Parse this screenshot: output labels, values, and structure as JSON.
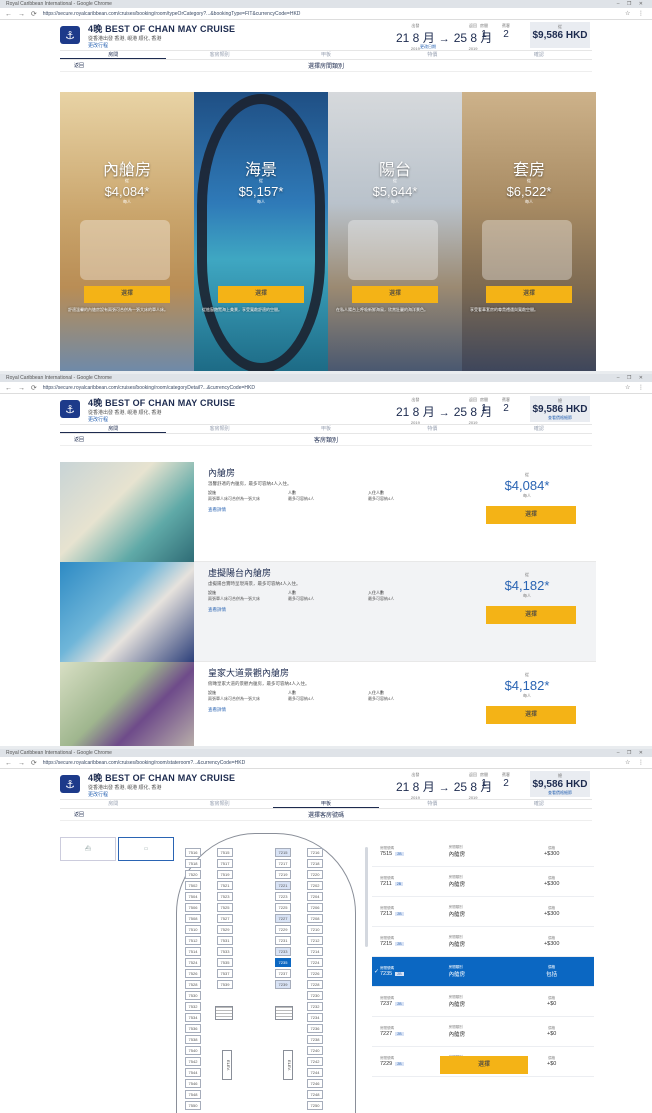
{
  "browser": {
    "window_title": "Royal Caribbean International - Google Chrome",
    "urls": [
      "https://secure.royalcaribbean.com/cruises/booking/room/typeOrCategory?...&bookingType=FIT&currencyCode=HKD",
      "https://secure.royalcaribbean.com/cruises/booking/room/categoryDetail?...&currencyCode=HKD",
      "https://secure.royalcaribbean.com/cruises/booking/room/stateroom?...&currencyCode=HKD"
    ]
  },
  "trip": {
    "title": "4晚 BEST OF CHAN MAY CRUISE",
    "subtitle": "從香港出發 香港, 峴港 顺化, 香港",
    "link": "更改行程",
    "depart_label": "出發",
    "depart": "21 8 月",
    "depart_year": "2019",
    "return_label": "返回",
    "return": "25 8 月",
    "return_year": "2019",
    "arrow": "→",
    "dates_link": "更改日期",
    "rooms_label": "房間",
    "rooms": "1",
    "guests_label": "賓客",
    "guests": "2",
    "total_label": "總",
    "total": "$9,586 HKD",
    "total_sub": "查看價格細節",
    "from_label": "從"
  },
  "steps": [
    "房間",
    "客房類別",
    "甲板",
    "特價",
    "確認"
  ],
  "frame1": {
    "back": "返回",
    "subtitle": "選擇房間類別",
    "categories": [
      {
        "name": "內艙房",
        "from": "從",
        "price": "$4,084*",
        "pp": "每人",
        "btn": "選擇",
        "desc": "舒適溫馨的內艙房設有兩張可合併為一張大床的單人床。"
      },
      {
        "name": "海景",
        "from": "從",
        "price": "$5,157*",
        "pp": "每人",
        "btn": "選擇",
        "desc": "從舷窗飽覽海上美景，享受寬敞舒適的空間。"
      },
      {
        "name": "陽台",
        "from": "從",
        "price": "$5,644*",
        "pp": "每人",
        "btn": "選擇",
        "desc": "在私人陽台上呼吸新鮮海風，欣賞壯麗的海洋景色。"
      },
      {
        "name": "套房",
        "from": "從",
        "price": "$6,522*",
        "pp": "每人",
        "btn": "選擇",
        "desc": "享受奢華套房的尊貴禮遇與寬敞空間。"
      }
    ]
  },
  "frame2": {
    "back": "返回",
    "subtitle": "客房類別",
    "rooms": [
      {
        "name": "內艙房",
        "desc": "溫馨舒適的內艙房，最多可容納4人入住。",
        "c1_label": "設施",
        "c1": "兩張單人床可合併為一張大床",
        "c2_label": "人數",
        "c2": "最多可容納4人",
        "c3_label": "入住人數",
        "c3": "最多可容納4人",
        "more": "查看詳情",
        "from": "從",
        "price": "$4,084*",
        "pp": "每人",
        "btn": "選擇"
      },
      {
        "name": "虛擬陽台內艙房",
        "desc": "虛擬陽台實時呈現海景，最多可容納4人入住。",
        "c1_label": "設施",
        "c1": "兩張單人床可合併為一張大床",
        "c2_label": "人數",
        "c2": "最多可容納4人",
        "c3_label": "入住人數",
        "c3": "最多可容納4人",
        "more": "查看詳情",
        "from": "從",
        "price": "$4,182*",
        "pp": "每人",
        "btn": "選擇"
      },
      {
        "name": "皇家大道景觀內艙房",
        "desc": "俯瞰皇家大道的景觀內艙房，最多可容納4人入住。",
        "c1_label": "設施",
        "c1": "兩張單人床可合併為一張大床",
        "c2_label": "人數",
        "c2": "最多可容納4人",
        "c3_label": "入住人數",
        "c3": "最多可容納4人",
        "more": "查看詳情",
        "from": "從",
        "price": "$4,182*",
        "pp": "每人",
        "btn": "選擇"
      }
    ]
  },
  "frame3": {
    "back": "返回",
    "subtitle": "選擇客房號碼",
    "elev": "ELEV.",
    "cabins_left": [
      "7516",
      "7518",
      "7520",
      "7502",
      "7504",
      "7506",
      "7508",
      "7510",
      "7512",
      "7514",
      "7524",
      "7526",
      "7528",
      "7530",
      "7532",
      "7534",
      "7536",
      "7538",
      "7540",
      "7542",
      "7544",
      "7546",
      "7548",
      "7550"
    ],
    "cabins_mid1": [
      "7515",
      "7517",
      "7519",
      "7521",
      "7523",
      "7525",
      "7527",
      "7529",
      "7531",
      "7533",
      "7535",
      "7537",
      "7539"
    ],
    "cabins_mid2": [
      "7215",
      "7217",
      "7219",
      "7221",
      "7223",
      "7225",
      "7227",
      "7229",
      "7231",
      "7233",
      "7235",
      "7237",
      "7239"
    ],
    "cabins_right": [
      "7216",
      "7218",
      "7220",
      "7202",
      "7204",
      "7206",
      "7208",
      "7210",
      "7212",
      "7214",
      "7224",
      "7226",
      "7228",
      "7230",
      "7232",
      "7234",
      "7236",
      "7238",
      "7240",
      "7242",
      "7244",
      "7246",
      "7248",
      "7250"
    ],
    "list": [
      {
        "l1": "房間號碼",
        "num": "7515",
        "tag": "2B",
        "l2": "房間類別",
        "type": "內艙房",
        "l3": "價格",
        "price": "+$300"
      },
      {
        "l1": "房間號碼",
        "num": "7211",
        "tag": "2B",
        "l2": "房間類別",
        "type": "內艙房",
        "l3": "價格",
        "price": "+$300"
      },
      {
        "l1": "房間號碼",
        "num": "7213",
        "tag": "2B",
        "l2": "房間類別",
        "type": "內艙房",
        "l3": "價格",
        "price": "+$300"
      },
      {
        "l1": "房間號碼",
        "num": "7215",
        "tag": "2B",
        "l2": "房間類別",
        "type": "內艙房",
        "l3": "價格",
        "price": "+$300"
      },
      {
        "l1": "房間號碼",
        "num": "7235",
        "tag": "2B",
        "l2": "房間類別",
        "type": "內艙房",
        "l3": "價格",
        "price": "包括"
      },
      {
        "l1": "房間號碼",
        "num": "7237",
        "tag": "2B",
        "l2": "房間類別",
        "type": "內艙房",
        "l3": "價格",
        "price": "+$0"
      },
      {
        "l1": "房間號碼",
        "num": "7227",
        "tag": "2B",
        "l2": "房間類別",
        "type": "內艙房",
        "l3": "價格",
        "price": "+$0"
      },
      {
        "l1": "房間號碼",
        "num": "7229",
        "tag": "2B",
        "l2": "房間類別",
        "type": "內艙房",
        "l3": "價格",
        "price": "+$0"
      }
    ],
    "select_btn": "選擇",
    "check": "✓"
  }
}
